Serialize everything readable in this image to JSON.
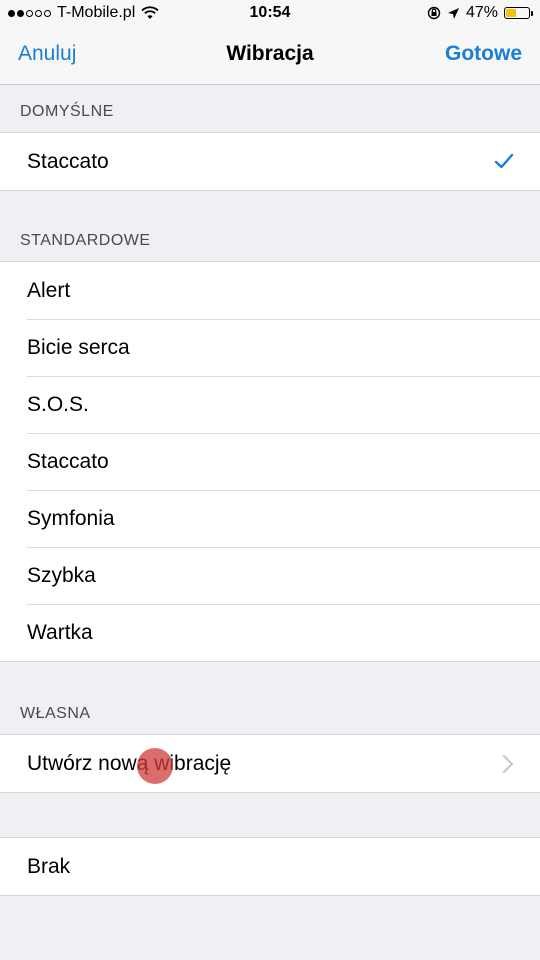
{
  "status_bar": {
    "carrier": "T-Mobile.pl",
    "time": "10:54",
    "battery_percent": "47%",
    "battery_level": 0.47,
    "signal_dots": [
      true,
      true,
      false,
      false,
      false
    ]
  },
  "nav": {
    "cancel_label": "Anuluj",
    "title": "Wibracja",
    "done_label": "Gotowe"
  },
  "sections": {
    "default": {
      "header": "DOMYŚLNE",
      "items": [
        {
          "label": "Staccato",
          "selected": true
        }
      ]
    },
    "standard": {
      "header": "STANDARDOWE",
      "items": [
        {
          "label": "Alert"
        },
        {
          "label": "Bicie serca"
        },
        {
          "label": "S.O.S."
        },
        {
          "label": "Staccato"
        },
        {
          "label": "Symfonia"
        },
        {
          "label": "Szybka"
        },
        {
          "label": "Wartka"
        }
      ]
    },
    "custom": {
      "header": "WŁASNA",
      "items": [
        {
          "label": "Utwórz nową wibrację"
        }
      ]
    },
    "none": {
      "items": [
        {
          "label": "Brak"
        }
      ]
    }
  },
  "colors": {
    "accent": "#1a7fd4",
    "background": "#efeff4",
    "battery": "#f5c400"
  }
}
